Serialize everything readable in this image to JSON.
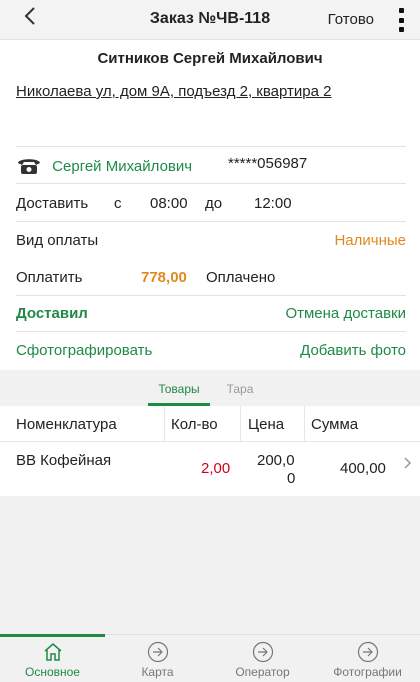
{
  "header": {
    "back_icon": "back-arrow-icon",
    "title": "Заказ №ЧВ-118",
    "done_label": "Готово",
    "menu_icon": "kebab-menu-icon"
  },
  "customer": {
    "name": "Ситников Сергей Михайлович",
    "address": "Николаева ул,  дом 9А,  подъезд 2,  квартира 2"
  },
  "contact": {
    "phone_icon": "phone-icon",
    "name": "Сергей Михайлович",
    "phone": "*****056987"
  },
  "delivery": {
    "label": "Доставить",
    "from_label": "с",
    "from": "08:00",
    "to_label": "до",
    "to": "12:00"
  },
  "payment": {
    "label": "Вид оплаты",
    "type": "Наличные"
  },
  "pay": {
    "label": "Оплатить",
    "amount": "778,00",
    "status": "Оплачено"
  },
  "actions": {
    "delivered": "Доставил",
    "cancel_delivery": "Отмена доставки",
    "take_photo": "Сфотографировать",
    "add_photo": "Добавить фото"
  },
  "tabs": [
    {
      "label": "Товары",
      "active": true
    },
    {
      "label": "Тара",
      "active": false
    }
  ],
  "table": {
    "columns": [
      "Номенклатура",
      "Кол-во",
      "Цена",
      "Сумма"
    ],
    "rows": [
      {
        "name": "ВВ Кофейная",
        "qty": "2,00",
        "price_line1": "200,0",
        "price_line2": "0",
        "sum": "400,00"
      }
    ]
  },
  "bottom_nav": [
    {
      "label": "Основное",
      "icon": "home-icon",
      "active": true
    },
    {
      "label": "Карта",
      "icon": "arrow-circle-icon",
      "active": false
    },
    {
      "label": "Оператор",
      "icon": "arrow-circle-icon",
      "active": false
    },
    {
      "label": "Фотографии",
      "icon": "arrow-circle-icon",
      "active": false
    }
  ],
  "colors": {
    "accent_green": "#1f8a46",
    "orange": "#e08a1e",
    "red": "#d0021b"
  }
}
